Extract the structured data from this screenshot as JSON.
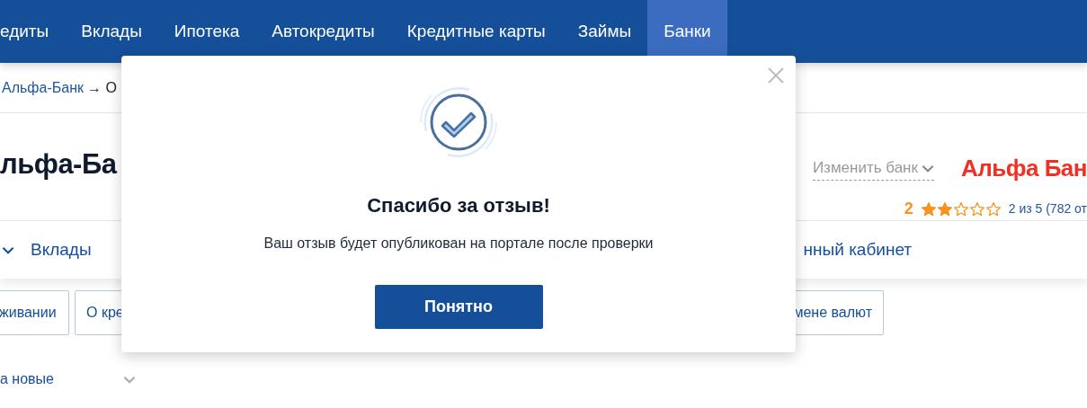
{
  "nav": {
    "items": [
      {
        "label": "едиты",
        "selected": false
      },
      {
        "label": "Вклады",
        "selected": false
      },
      {
        "label": "Ипотека",
        "selected": false
      },
      {
        "label": "Автокредиты",
        "selected": false
      },
      {
        "label": "Кредитные карты",
        "selected": false
      },
      {
        "label": "Займы",
        "selected": false
      },
      {
        "label": "Банки",
        "selected": true
      }
    ]
  },
  "breadcrumb": {
    "link": "Альфа-Банк",
    "arrow": "→",
    "current": "О"
  },
  "bank": {
    "title": "льфа-Ба",
    "change_bank": "Изменить банк",
    "logo": "Альфа Бан",
    "rating": {
      "score": "2",
      "stars": 2,
      "text": "2 из 5 (782 от"
    }
  },
  "subnav": {
    "left": [
      "Вклады"
    ],
    "right": "нный кабинет"
  },
  "chips": [
    "живании",
    "О кре",
    "мене валют"
  ],
  "sort": {
    "label": "а новые"
  },
  "modal": {
    "title": "Спасибо за отзыв!",
    "message": "Ваш отзыв будет опубликован на портале после проверки",
    "button": "Понятно"
  }
}
